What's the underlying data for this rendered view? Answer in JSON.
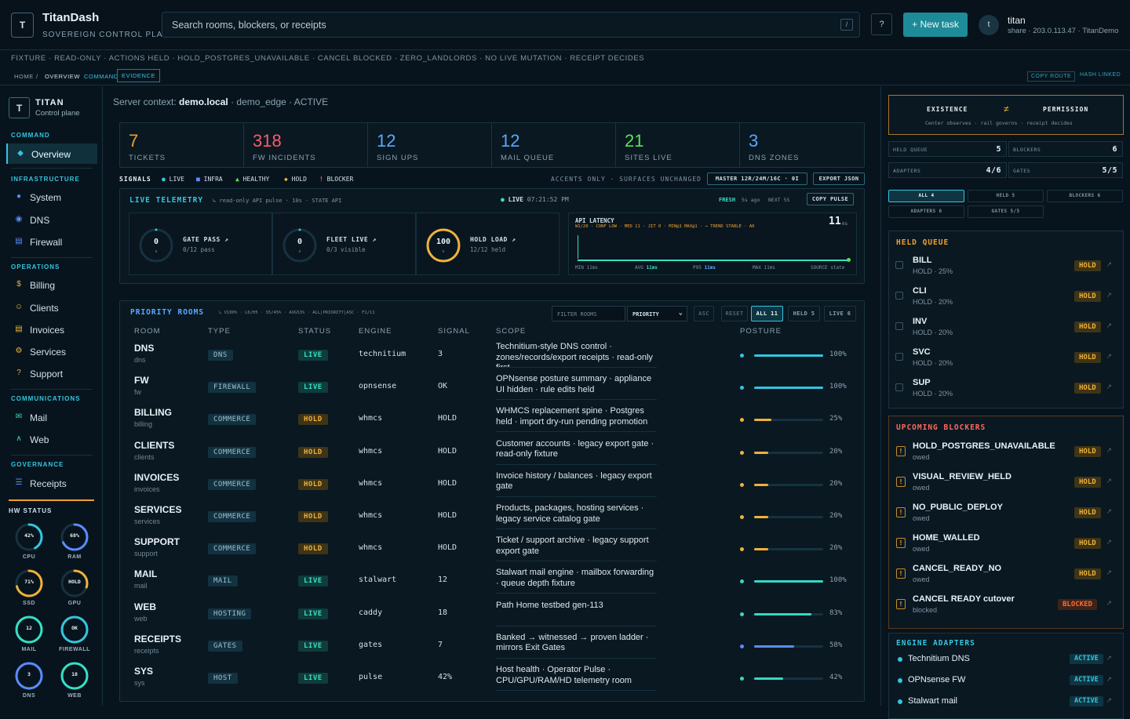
{
  "app": {
    "logo_letter": "T",
    "name": "TitanDash",
    "subtitle": "SOVEREIGN CONTROL PLANE"
  },
  "search": {
    "placeholder": "Search rooms, blockers, or receipts",
    "shortcut": "/"
  },
  "header": {
    "help_label": "?",
    "new_task_label": "+ New task",
    "avatar_letter": "t",
    "user_name": "titan",
    "user_meta": "share · 203.0.113.47 · TitanDemo"
  },
  "fixture_banner": "FIXTURE · READ-ONLY · ACTIONS HELD · HOLD_POSTGRES_UNAVAILABLE · CANCEL BLOCKED · ZERO_LANDLORDS · NO LIVE MUTATION · RECEIPT DECIDES",
  "breadcrumb": {
    "home": "HOME",
    "sep": "/",
    "overview": "OVERVIEW",
    "command": "COMMAND",
    "evidence": "EVIDENCE",
    "copy_route": "COPY ROUTE",
    "hash_linked": "HASH LINKED"
  },
  "sidebar": {
    "logo_letter": "T",
    "title": "TITAN",
    "subtitle": "Control plane",
    "sections": {
      "command": "COMMAND",
      "infrastructure": "INFRASTRUCTURE",
      "operations": "OPERATIONS",
      "communications": "COMMUNICATIONS",
      "governance": "GOVERNANCE",
      "hw_status": "HW STATUS"
    },
    "items": {
      "overview": "Overview",
      "system": "System",
      "dns": "DNS",
      "firewall": "Firewall",
      "billing": "Billing",
      "clients": "Clients",
      "invoices": "Invoices",
      "services": "Services",
      "support": "Support",
      "mail": "Mail",
      "web": "Web",
      "receipts": "Receipts"
    },
    "hw": [
      {
        "value": "42%",
        "label": "CPU",
        "fraction": 0.42,
        "color": "#33c6e0"
      },
      {
        "value": "68%",
        "label": "RAM",
        "fraction": 0.68,
        "color": "#5b8cff"
      },
      {
        "value": "71%",
        "label": "SSD",
        "fraction": 0.71,
        "color": "#f0b13a"
      },
      {
        "value": "HOLD",
        "label": "GPU",
        "fraction": 0.3,
        "color": "#f0b13a"
      },
      {
        "value": "12",
        "label": "MAIL",
        "fraction": 1.0,
        "color": "#36e0c4"
      },
      {
        "value": "OK",
        "label": "FIREWALL",
        "fraction": 1.0,
        "color": "#33c6e0"
      },
      {
        "value": "3",
        "label": "DNS",
        "fraction": 1.0,
        "color": "#5b8cff"
      },
      {
        "value": "18",
        "label": "WEB",
        "fraction": 1.0,
        "color": "#36e0c4"
      }
    ]
  },
  "context": {
    "prefix": "Server context:",
    "host": "demo.local",
    "suffix": "· demo_edge · ACTIVE"
  },
  "stats": [
    {
      "value": "7",
      "label": "TICKETS",
      "color": "#f0a030"
    },
    {
      "value": "318",
      "label": "FW INCIDENTS",
      "color": "#ff5a6a"
    },
    {
      "value": "12",
      "label": "SIGN UPS",
      "color": "#5aa8ff"
    },
    {
      "value": "12",
      "label": "MAIL QUEUE",
      "color": "#5aa8ff"
    },
    {
      "value": "21",
      "label": "SITES LIVE",
      "color": "#5ae05a"
    },
    {
      "value": "3",
      "label": "DNS ZONES",
      "color": "#5aa8ff"
    }
  ],
  "signals": {
    "label": "SIGNALS",
    "live": "LIVE",
    "infra": "INFRA",
    "healthy": "HEALTHY",
    "hold": "HOLD",
    "blocker": "BLOCKER",
    "note": "ACCENTS ONLY · SURFACES UNCHANGED",
    "master": "MASTER 12R/24M/16C · 0I",
    "export": "EXPORT JSON"
  },
  "telemetry": {
    "title": "LIVE TELEMETRY",
    "sub": "↳ read-only API pulse · 10s · STATE API",
    "live": "LIVE",
    "time": "07:21:52 PM",
    "fresh": "FRESH",
    "fresh_ago": "5s ago",
    "next": "NEXT 5S",
    "copy": "COPY PULSE",
    "gauges": [
      {
        "value": "0",
        "unit": "s",
        "title": "GATE PASS ↗",
        "sub": "0/12 pass",
        "fraction": 0.0,
        "color": "#33c6e0"
      },
      {
        "value": "0",
        "unit": "s",
        "title": "FLEET LIVE ↗",
        "sub": "0/3 visible",
        "fraction": 0.0,
        "color": "#33c6e0"
      },
      {
        "value": "100",
        "unit": "s",
        "title": "HOLD LOAD ↗",
        "sub": "12/12 held",
        "fraction": 1.0,
        "color": "#f0b13a"
      }
    ],
    "latency": {
      "title": "API LATENCY",
      "legend": "W1/20 · CONF LOW · MED 11 · JIT 0 · MIN@1 MAX@1 · → TREND STABLE · A0",
      "value": "11",
      "unit": "ms",
      "min_label": "MIN",
      "min": "11ms",
      "avg_label": "AVG",
      "avg": "11ms",
      "p95_label": "P95",
      "p95": "11ms",
      "max_label": "MAX",
      "max": "11ms",
      "source_label": "SOURCE",
      "source": "state"
    }
  },
  "rooms": {
    "title": "PRIORITY ROOMS",
    "sub": "↳ V100% · L6/H5 · S5/45% · AVG53% · ALL|PRIORITY|ASC · F1/11",
    "filter_placeholder": "FILTER ROOMS",
    "sort": "PRIORITY",
    "asc": "ASC",
    "reset": "RESET",
    "all": "ALL 11",
    "held": "HELD 5",
    "live": "LIVE 6",
    "headers": {
      "room": "ROOM",
      "type": "TYPE",
      "status": "STATUS",
      "engine": "ENGINE",
      "signal": "SIGNAL",
      "scope": "SCOPE",
      "posture": "POSTURE"
    },
    "rows": [
      {
        "name": "DNS",
        "slug": "dns",
        "type": "DNS",
        "status": "LIVE",
        "engine": "technitium",
        "signal": "3",
        "scope": "Technitium-style DNS control · zones/records/export receipts · read-only first",
        "posture": "100%",
        "fraction": 1.0,
        "color": "#33c6e0"
      },
      {
        "name": "FW",
        "slug": "fw",
        "type": "FIREWALL",
        "status": "LIVE",
        "engine": "opnsense",
        "signal": "OK",
        "scope": "OPNsense posture summary · appliance UI hidden · rule edits held",
        "posture": "100%",
        "fraction": 1.0,
        "color": "#33c6e0"
      },
      {
        "name": "BILLING",
        "slug": "billing",
        "type": "COMMERCE",
        "status": "HOLD",
        "engine": "whmcs",
        "signal": "HOLD",
        "scope": "WHMCS replacement spine · Postgres held · import dry-run pending promotion",
        "posture": "25%",
        "fraction": 0.25,
        "color": "#f0b13a"
      },
      {
        "name": "CLIENTS",
        "slug": "clients",
        "type": "COMMERCE",
        "status": "HOLD",
        "engine": "whmcs",
        "signal": "HOLD",
        "scope": "Customer accounts · legacy export gate · read-only fixture",
        "posture": "20%",
        "fraction": 0.2,
        "color": "#f0b13a"
      },
      {
        "name": "INVOICES",
        "slug": "invoices",
        "type": "COMMERCE",
        "status": "HOLD",
        "engine": "whmcs",
        "signal": "HOLD",
        "scope": "Invoice history / balances · legacy export gate",
        "posture": "20%",
        "fraction": 0.2,
        "color": "#f0b13a"
      },
      {
        "name": "SERVICES",
        "slug": "services",
        "type": "COMMERCE",
        "status": "HOLD",
        "engine": "whmcs",
        "signal": "HOLD",
        "scope": "Products, packages, hosting services · legacy service catalog gate",
        "posture": "20%",
        "fraction": 0.2,
        "color": "#f0b13a"
      },
      {
        "name": "SUPPORT",
        "slug": "support",
        "type": "COMMERCE",
        "status": "HOLD",
        "engine": "whmcs",
        "signal": "HOLD",
        "scope": "Ticket / support archive · legacy support export gate",
        "posture": "20%",
        "fraction": 0.2,
        "color": "#f0b13a"
      },
      {
        "name": "MAIL",
        "slug": "mail",
        "type": "MAIL",
        "status": "LIVE",
        "engine": "stalwart",
        "signal": "12",
        "scope": "Stalwart mail engine · mailbox forwarding · queue depth fixture",
        "posture": "100%",
        "fraction": 1.0,
        "color": "#36d8c4"
      },
      {
        "name": "WEB",
        "slug": "web",
        "type": "HOSTING",
        "status": "LIVE",
        "engine": "caddy",
        "signal": "18",
        "scope": "Path Home testbed gen-113",
        "posture": "83%",
        "fraction": 0.83,
        "color": "#36d8c4"
      },
      {
        "name": "RECEIPTS",
        "slug": "receipts",
        "type": "GATES",
        "status": "LIVE",
        "engine": "gates",
        "signal": "7",
        "scope": "Banked → witnessed → proven ladder · mirrors Exit Gates",
        "posture": "58%",
        "fraction": 0.58,
        "color": "#5b8cff"
      },
      {
        "name": "SYS",
        "slug": "sys",
        "type": "HOST",
        "status": "LIVE",
        "engine": "pulse",
        "signal": "42%",
        "scope": "Host health · Operator Pulse · CPU/GPU/RAM/HD telemetry room",
        "posture": "42%",
        "fraction": 0.42,
        "color": "#36d8c4"
      }
    ]
  },
  "right": {
    "existence": "EXISTENCE",
    "neq": "≠",
    "permission": "PERMISSION",
    "principle": "Center observes · rail governs · receipt decides",
    "counters": [
      {
        "label": "HELD QUEUE",
        "value": "5"
      },
      {
        "label": "BLOCKERS",
        "value": "6"
      },
      {
        "label": "ADAPTERS",
        "value": "4/6"
      },
      {
        "label": "GATES",
        "value": "5/5"
      }
    ],
    "filters": [
      "ALL 4",
      "HELD 5",
      "BLOCKERS 6",
      "ADAPTERS 6",
      "GATES 5/5"
    ],
    "held_title": "HELD QUEUE",
    "held": [
      {
        "name": "BILL",
        "sub": "HOLD · 25%",
        "badge": "HOLD"
      },
      {
        "name": "CLI",
        "sub": "HOLD · 20%",
        "badge": "HOLD"
      },
      {
        "name": "INV",
        "sub": "HOLD · 20%",
        "badge": "HOLD"
      },
      {
        "name": "SVC",
        "sub": "HOLD · 20%",
        "badge": "HOLD"
      },
      {
        "name": "SUP",
        "sub": "HOLD · 20%",
        "badge": "HOLD"
      }
    ],
    "blockers_title": "UPCOMING BLOCKERS",
    "blockers": [
      {
        "name": "HOLD_POSTGRES_UNAVAILABLE",
        "sub": "owed",
        "badge": "HOLD"
      },
      {
        "name": "VISUAL_REVIEW_HELD",
        "sub": "owed",
        "badge": "HOLD"
      },
      {
        "name": "NO_PUBLIC_DEPLOY",
        "sub": "owed",
        "badge": "HOLD"
      },
      {
        "name": "HOME_WALLED",
        "sub": "owed",
        "badge": "HOLD"
      },
      {
        "name": "CANCEL_READY_NO",
        "sub": "owed",
        "badge": "HOLD"
      },
      {
        "name": "CANCEL READY cutover",
        "sub": "blocked",
        "badge": "BLOCKED"
      }
    ],
    "adapters_title": "ENGINE ADAPTERS",
    "adapters": [
      {
        "name": "Technitium DNS",
        "badge": "ACTIVE"
      },
      {
        "name": "OPNsense FW",
        "badge": "ACTIVE"
      },
      {
        "name": "Stalwart mail",
        "badge": "ACTIVE"
      }
    ]
  }
}
